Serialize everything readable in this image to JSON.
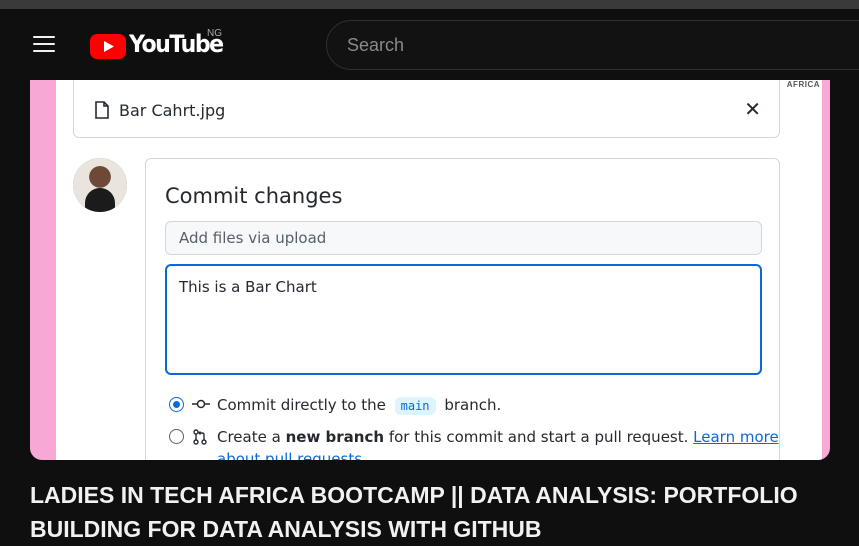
{
  "header": {
    "logo_text": "YouTube",
    "country": "NG",
    "search_placeholder": "Search"
  },
  "github": {
    "watermark": "AFRICA",
    "file_name": "Bar Cahrt.jpg",
    "commit_title": "Commit changes",
    "summary_placeholder": "Add files via upload",
    "description_value": "This is a Bar Chart",
    "option_direct": {
      "prefix": "Commit directly to the",
      "branch": "main",
      "suffix": "branch."
    },
    "option_new": {
      "prefix": "Create a",
      "bold": "new branch",
      "middle": "for this commit and start a pull request.",
      "link": "Learn more",
      "link_wrap": "about pull requests"
    }
  },
  "video": {
    "title": "LADIES IN TECH AFRICA BOOTCAMP || DATA ANALYSIS: PORTFOLIO BUILDING FOR DATA ANALYSIS WITH GITHUB"
  },
  "colors": {
    "accent": "#0969da",
    "youtube_red": "#ff0000",
    "frame_pink": "#f7a8d4"
  }
}
